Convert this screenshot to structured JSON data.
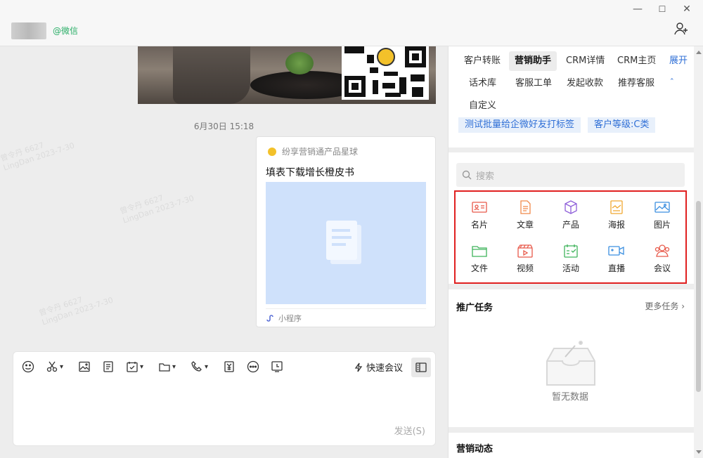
{
  "window": {
    "contact_suffix": "@微信",
    "minimize": "—",
    "maximize": "☐",
    "close": "✕"
  },
  "chat": {
    "timestamp": "6月30日 15:18",
    "card": {
      "source": "纷享营销通产品星球",
      "title": "填表下载增长橙皮书",
      "footer": "小程序"
    },
    "watermarks": [
      {
        "line1": "曾令丹 6627",
        "line2": "LingDan 2023-7-30"
      }
    ]
  },
  "composer": {
    "quick_meeting": "快速会议",
    "send": "发送(S)"
  },
  "panel": {
    "tabs_row1": [
      "客户转账",
      "营销助手",
      "CRM详情",
      "CRM主页"
    ],
    "expand": "展开",
    "tabs_row2": [
      "话术库",
      "客服工单",
      "发起收款",
      "推荐客服"
    ],
    "tabs_row3": [
      "自定义"
    ],
    "tags": [
      "测试批量给企微好友打标签",
      "客户等级:C类"
    ],
    "search_placeholder": "搜索",
    "grid": [
      {
        "label": "名片",
        "icon": "business-card-icon",
        "color": "#e8594a"
      },
      {
        "label": "文章",
        "icon": "article-icon",
        "color": "#f08a4b"
      },
      {
        "label": "产品",
        "icon": "product-box-icon",
        "color": "#8e5fd9"
      },
      {
        "label": "海报",
        "icon": "poster-icon",
        "color": "#f0a830"
      },
      {
        "label": "图片",
        "icon": "image-icon",
        "color": "#3b8fe0"
      },
      {
        "label": "文件",
        "icon": "folder-icon",
        "color": "#3fb35b"
      },
      {
        "label": "视频",
        "icon": "video-clapper-icon",
        "color": "#e8594a"
      },
      {
        "label": "活动",
        "icon": "activity-calendar-icon",
        "color": "#3fb35b"
      },
      {
        "label": "直播",
        "icon": "live-camera-icon",
        "color": "#3b8fe0"
      },
      {
        "label": "会议",
        "icon": "meeting-people-icon",
        "color": "#e8594a"
      }
    ],
    "tasks_title": "推广任务",
    "tasks_more": "更多任务",
    "empty_text": "暂无数据",
    "marketing_title": "营销动态"
  }
}
